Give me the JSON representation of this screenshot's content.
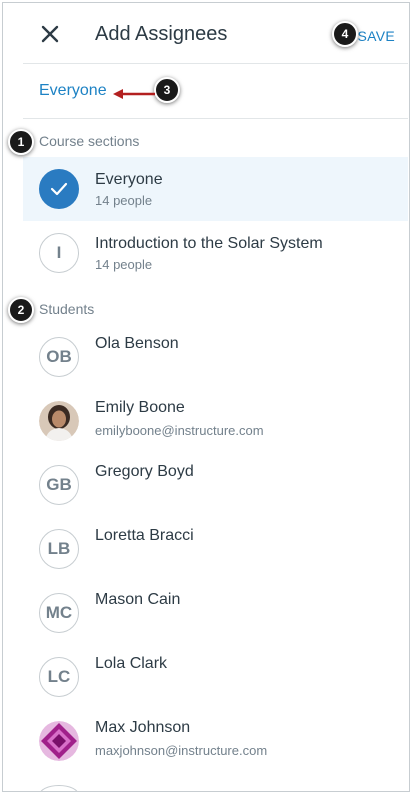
{
  "header": {
    "title": "Add Assignees",
    "save_label": "SAVE"
  },
  "selected_assignee": "Everyone",
  "sections": {
    "course_sections_label": "Course sections",
    "students_label": "Students"
  },
  "course_sections": [
    {
      "name": "Everyone",
      "count": "14 people",
      "selected": true
    },
    {
      "name": "Introduction to the Solar System",
      "count": "14 people",
      "initials": "I",
      "selected": false
    }
  ],
  "students": [
    {
      "name": "Ola Benson",
      "initials": "OB",
      "email": ""
    },
    {
      "name": "Emily Boone",
      "initials": "",
      "email": "emilyboone@instructure.com",
      "photo": "portrait"
    },
    {
      "name": "Gregory Boyd",
      "initials": "GB",
      "email": ""
    },
    {
      "name": "Loretta Bracci",
      "initials": "LB",
      "email": ""
    },
    {
      "name": "Mason Cain",
      "initials": "MC",
      "email": ""
    },
    {
      "name": "Lola Clark",
      "initials": "LC",
      "email": ""
    },
    {
      "name": "Max Johnson",
      "initials": "",
      "email": "maxjohnson@instructure.com",
      "photo": "pattern"
    }
  ],
  "callouts": [
    "1",
    "2",
    "3",
    "4"
  ],
  "colors": {
    "accent": "#1d82c4",
    "selected_row_bg": "#eef6fc",
    "check_circle": "#2a7bc1",
    "arrow": "#b32020",
    "callout_bg": "#1a1a1a"
  },
  "icons": {
    "close": "close-icon",
    "check": "check-icon",
    "arrow": "red-arrow-icon"
  }
}
